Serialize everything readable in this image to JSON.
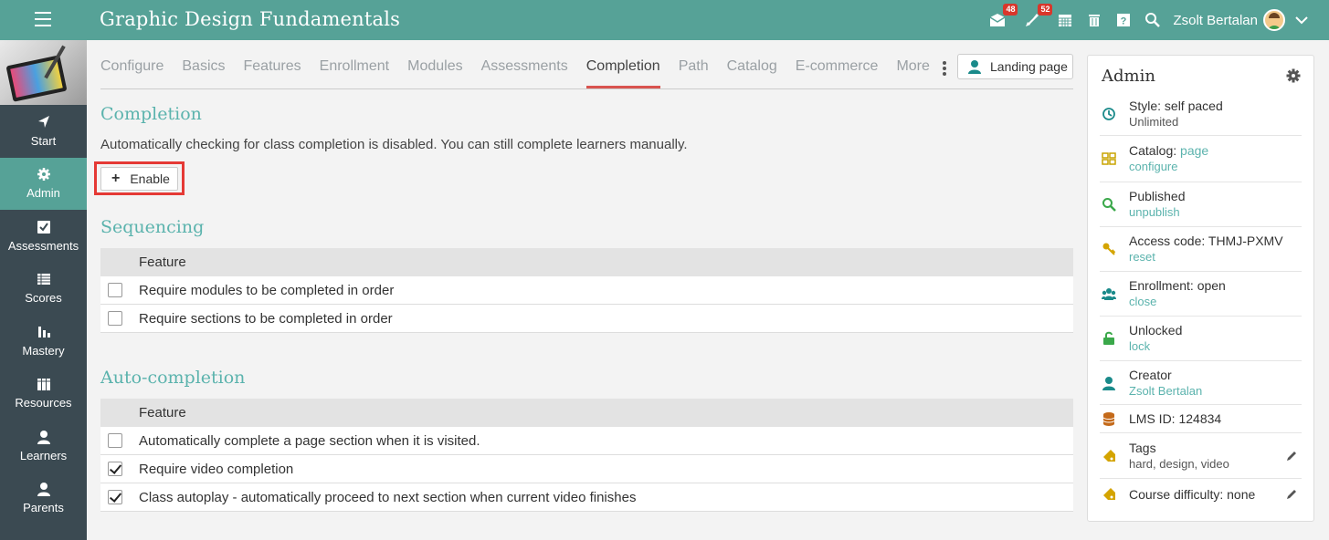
{
  "header": {
    "title": "Graphic Design Fundamentals",
    "messages_badge": "48",
    "notifications_badge": "52",
    "user_name": "Zsolt Bertalan"
  },
  "sidebar": {
    "items": [
      {
        "label": "Start",
        "icon": "navigation-arrow-icon"
      },
      {
        "label": "Admin",
        "icon": "gear-icon",
        "active": true
      },
      {
        "label": "Assessments",
        "icon": "checkbox-icon"
      },
      {
        "label": "Scores",
        "icon": "gradebook-icon"
      },
      {
        "label": "Mastery",
        "icon": "bar-chart-icon"
      },
      {
        "label": "Resources",
        "icon": "library-icon"
      },
      {
        "label": "Learners",
        "icon": "person-icon"
      },
      {
        "label": "Parents",
        "icon": "person-icon"
      }
    ]
  },
  "tabs": {
    "items": [
      "Configure",
      "Basics",
      "Features",
      "Enrollment",
      "Modules",
      "Assessments",
      "Completion",
      "Path",
      "Catalog",
      "E-commerce",
      "More"
    ],
    "active": "Completion",
    "landing_page": "Landing page"
  },
  "completion": {
    "title": "Completion",
    "info": "Automatically checking for class completion is disabled. You can still complete learners manually.",
    "enable_label": "Enable"
  },
  "sequencing": {
    "title": "Sequencing",
    "header": "Feature",
    "rows": [
      {
        "label": "Require modules to be completed in order",
        "checked": false
      },
      {
        "label": "Require sections to be completed in order",
        "checked": false
      }
    ]
  },
  "auto_completion": {
    "title": "Auto-completion",
    "header": "Feature",
    "rows": [
      {
        "label": "Automatically complete a page section when it is visited.",
        "checked": false
      },
      {
        "label": "Require video completion",
        "checked": true
      },
      {
        "label": "Class autoplay - automatically proceed to next section when current video finishes",
        "checked": true
      }
    ]
  },
  "admin_panel": {
    "title": "Admin",
    "style_main": "Style: self paced",
    "style_sub": "Unlimited",
    "catalog_main": "Catalog: ",
    "catalog_link": "page",
    "catalog_sub": "configure",
    "published_main": "Published",
    "published_sub": "unpublish",
    "access_main": "Access code: THMJ-PXMV",
    "access_sub": "reset",
    "enrollment_main": "Enrollment: open",
    "enrollment_sub": "close",
    "unlocked_main": "Unlocked",
    "unlocked_sub": "lock",
    "creator_main": "Creator",
    "creator_sub": "Zsolt Bertalan",
    "lms_main": "LMS ID: 124834",
    "tags_main": "Tags",
    "tags_sub": "hard, design, video",
    "difficulty_main": "Course difficulty: none"
  },
  "colors": {
    "brand": "#56a297",
    "sidebar": "#3b4a52",
    "accent_title": "#5bb3ad",
    "active_tab_underline": "#d9534f",
    "highlight_outline": "#e53935",
    "badge": "#d9362b"
  }
}
